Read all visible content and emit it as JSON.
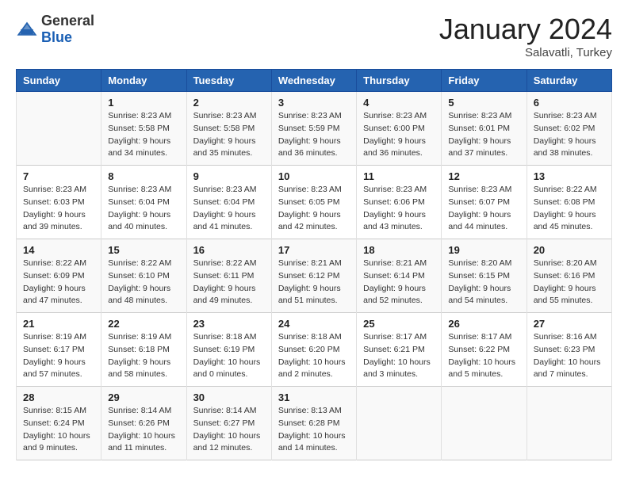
{
  "logo": {
    "general": "General",
    "blue": "Blue"
  },
  "header": {
    "month": "January 2024",
    "location": "Salavatli, Turkey"
  },
  "weekdays": [
    "Sunday",
    "Monday",
    "Tuesday",
    "Wednesday",
    "Thursday",
    "Friday",
    "Saturday"
  ],
  "weeks": [
    [
      {
        "day": "",
        "info": ""
      },
      {
        "day": "1",
        "info": "Sunrise: 8:23 AM\nSunset: 5:58 PM\nDaylight: 9 hours\nand 34 minutes."
      },
      {
        "day": "2",
        "info": "Sunrise: 8:23 AM\nSunset: 5:58 PM\nDaylight: 9 hours\nand 35 minutes."
      },
      {
        "day": "3",
        "info": "Sunrise: 8:23 AM\nSunset: 5:59 PM\nDaylight: 9 hours\nand 36 minutes."
      },
      {
        "day": "4",
        "info": "Sunrise: 8:23 AM\nSunset: 6:00 PM\nDaylight: 9 hours\nand 36 minutes."
      },
      {
        "day": "5",
        "info": "Sunrise: 8:23 AM\nSunset: 6:01 PM\nDaylight: 9 hours\nand 37 minutes."
      },
      {
        "day": "6",
        "info": "Sunrise: 8:23 AM\nSunset: 6:02 PM\nDaylight: 9 hours\nand 38 minutes."
      }
    ],
    [
      {
        "day": "7",
        "info": "Sunrise: 8:23 AM\nSunset: 6:03 PM\nDaylight: 9 hours\nand 39 minutes."
      },
      {
        "day": "8",
        "info": "Sunrise: 8:23 AM\nSunset: 6:04 PM\nDaylight: 9 hours\nand 40 minutes."
      },
      {
        "day": "9",
        "info": "Sunrise: 8:23 AM\nSunset: 6:04 PM\nDaylight: 9 hours\nand 41 minutes."
      },
      {
        "day": "10",
        "info": "Sunrise: 8:23 AM\nSunset: 6:05 PM\nDaylight: 9 hours\nand 42 minutes."
      },
      {
        "day": "11",
        "info": "Sunrise: 8:23 AM\nSunset: 6:06 PM\nDaylight: 9 hours\nand 43 minutes."
      },
      {
        "day": "12",
        "info": "Sunrise: 8:23 AM\nSunset: 6:07 PM\nDaylight: 9 hours\nand 44 minutes."
      },
      {
        "day": "13",
        "info": "Sunrise: 8:22 AM\nSunset: 6:08 PM\nDaylight: 9 hours\nand 45 minutes."
      }
    ],
    [
      {
        "day": "14",
        "info": "Sunrise: 8:22 AM\nSunset: 6:09 PM\nDaylight: 9 hours\nand 47 minutes."
      },
      {
        "day": "15",
        "info": "Sunrise: 8:22 AM\nSunset: 6:10 PM\nDaylight: 9 hours\nand 48 minutes."
      },
      {
        "day": "16",
        "info": "Sunrise: 8:22 AM\nSunset: 6:11 PM\nDaylight: 9 hours\nand 49 minutes."
      },
      {
        "day": "17",
        "info": "Sunrise: 8:21 AM\nSunset: 6:12 PM\nDaylight: 9 hours\nand 51 minutes."
      },
      {
        "day": "18",
        "info": "Sunrise: 8:21 AM\nSunset: 6:14 PM\nDaylight: 9 hours\nand 52 minutes."
      },
      {
        "day": "19",
        "info": "Sunrise: 8:20 AM\nSunset: 6:15 PM\nDaylight: 9 hours\nand 54 minutes."
      },
      {
        "day": "20",
        "info": "Sunrise: 8:20 AM\nSunset: 6:16 PM\nDaylight: 9 hours\nand 55 minutes."
      }
    ],
    [
      {
        "day": "21",
        "info": "Sunrise: 8:19 AM\nSunset: 6:17 PM\nDaylight: 9 hours\nand 57 minutes."
      },
      {
        "day": "22",
        "info": "Sunrise: 8:19 AM\nSunset: 6:18 PM\nDaylight: 9 hours\nand 58 minutes."
      },
      {
        "day": "23",
        "info": "Sunrise: 8:18 AM\nSunset: 6:19 PM\nDaylight: 10 hours\nand 0 minutes."
      },
      {
        "day": "24",
        "info": "Sunrise: 8:18 AM\nSunset: 6:20 PM\nDaylight: 10 hours\nand 2 minutes."
      },
      {
        "day": "25",
        "info": "Sunrise: 8:17 AM\nSunset: 6:21 PM\nDaylight: 10 hours\nand 3 minutes."
      },
      {
        "day": "26",
        "info": "Sunrise: 8:17 AM\nSunset: 6:22 PM\nDaylight: 10 hours\nand 5 minutes."
      },
      {
        "day": "27",
        "info": "Sunrise: 8:16 AM\nSunset: 6:23 PM\nDaylight: 10 hours\nand 7 minutes."
      }
    ],
    [
      {
        "day": "28",
        "info": "Sunrise: 8:15 AM\nSunset: 6:24 PM\nDaylight: 10 hours\nand 9 minutes."
      },
      {
        "day": "29",
        "info": "Sunrise: 8:14 AM\nSunset: 6:26 PM\nDaylight: 10 hours\nand 11 minutes."
      },
      {
        "day": "30",
        "info": "Sunrise: 8:14 AM\nSunset: 6:27 PM\nDaylight: 10 hours\nand 12 minutes."
      },
      {
        "day": "31",
        "info": "Sunrise: 8:13 AM\nSunset: 6:28 PM\nDaylight: 10 hours\nand 14 minutes."
      },
      {
        "day": "",
        "info": ""
      },
      {
        "day": "",
        "info": ""
      },
      {
        "day": "",
        "info": ""
      }
    ]
  ]
}
